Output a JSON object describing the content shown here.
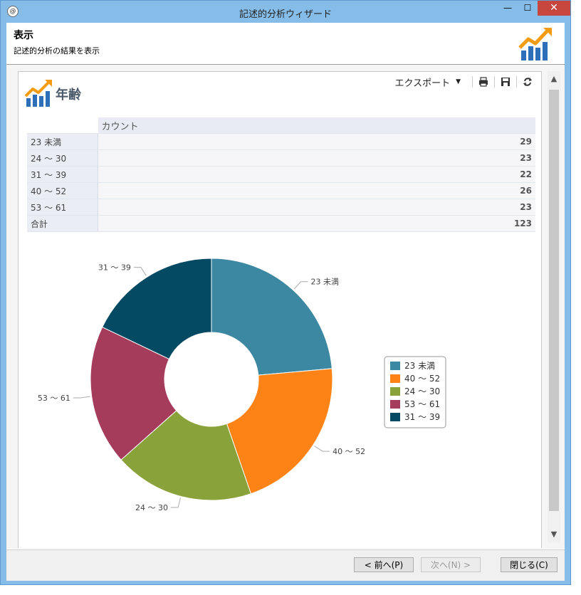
{
  "window": {
    "title": "記述的分析ウィザード",
    "close_glyph": "✕",
    "min_glyph": "—",
    "max_glyph": "☐"
  },
  "header": {
    "title": "表示",
    "subtitle": "記述的分析の結果を表示"
  },
  "panel": {
    "title": "年齢",
    "export_label": "エクスポート"
  },
  "table": {
    "column_header": "カウント",
    "rows": [
      {
        "label": "23 未満",
        "value": "29"
      },
      {
        "label": "24 ～ 30",
        "value": "23"
      },
      {
        "label": "31 ～ 39",
        "value": "22"
      },
      {
        "label": "40 ～ 52",
        "value": "26"
      },
      {
        "label": "53 ～ 61",
        "value": "23"
      },
      {
        "label": "合計",
        "value": "123"
      }
    ]
  },
  "chart_data": {
    "type": "pie",
    "donut": true,
    "slices": [
      {
        "label": "23 未満",
        "value": 29,
        "color": "#3c87a2"
      },
      {
        "label": "40 ～ 52",
        "value": 26,
        "color": "#fe8316"
      },
      {
        "label": "24 ～ 30",
        "value": 23,
        "color": "#8aa23a"
      },
      {
        "label": "53 ～ 61",
        "value": 23,
        "color": "#a53c5c"
      },
      {
        "label": "31 ～ 39",
        "value": 22,
        "color": "#054a63"
      }
    ],
    "legend": [
      "23 未満",
      "40 ～ 52",
      "24 ～ 30",
      "53 ～ 61",
      "31 ～ 39"
    ],
    "legend_position": "right"
  },
  "footer": {
    "prev": "< 前へ(P)",
    "next": "次へ(N) >",
    "close": "閉じる(C)"
  }
}
